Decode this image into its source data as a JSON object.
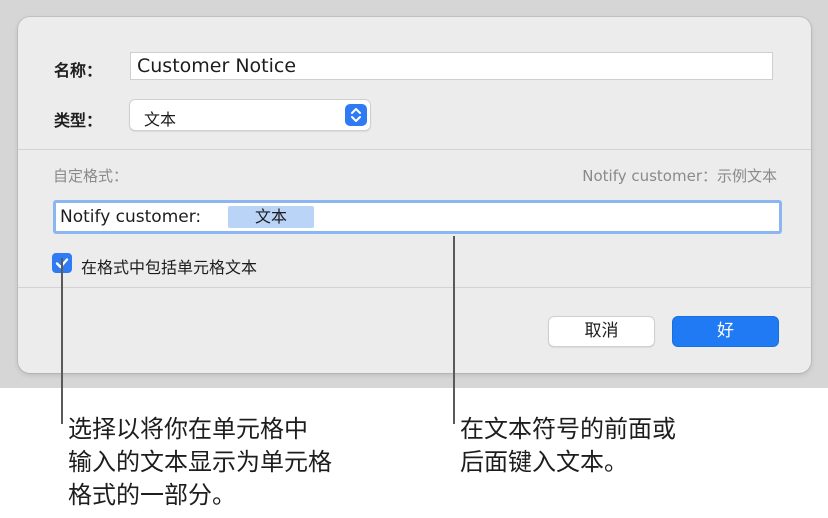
{
  "dialog": {
    "name_label": "名称：",
    "name_value": "Customer Notice",
    "type_label": "类型：",
    "type_value": "文本",
    "custom_format_label": "自定格式：",
    "preview_text": "Notify customer：示例文本",
    "format_prefix": "Notify customer:",
    "format_token": "文本",
    "include_checkbox_label": "在格式中包括单元格文本",
    "include_checked": true,
    "cancel_label": "取消",
    "ok_label": "好"
  },
  "callouts": {
    "left_line1": "选择以将你在单元格中",
    "left_line2": "输入的文本显示为单元格",
    "left_line3": "格式的一部分。",
    "right_line1": "在文本符号的前面或",
    "right_line2": "后面键入文本。"
  },
  "colors": {
    "accent": "#1f7af4",
    "token_bg": "#b9d4f7",
    "focus_ring": "#8cb6f2",
    "dialog_bg": "#ececec"
  },
  "icons": {
    "stepper": "chevron-up-down-icon",
    "checkbox": "checkmark-icon"
  }
}
